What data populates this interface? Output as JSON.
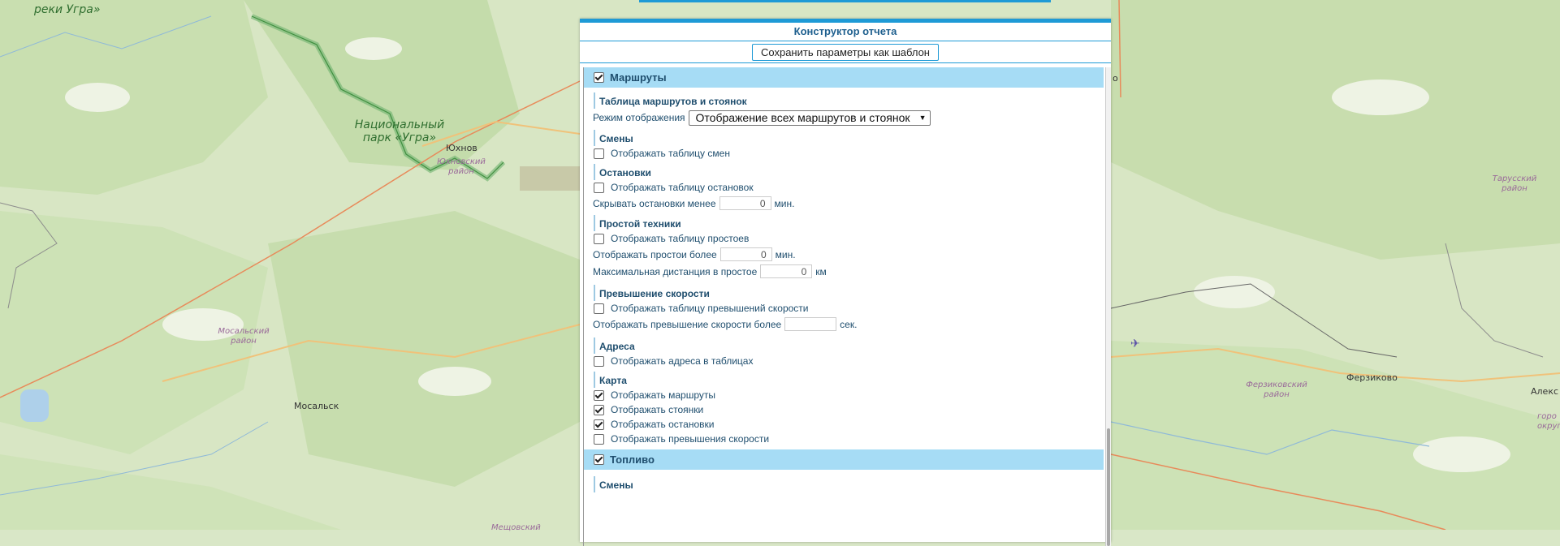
{
  "map": {
    "labels": {
      "river": "реки Угра»",
      "park_line1": "Национальный",
      "park_line2": "парк «Угра»",
      "yukhnov": "Юхнов",
      "yukhnov_rayon_1": "Юхновский",
      "yukhnov_rayon_2": "район",
      "mosalsk_rayon_1": "Мосальский",
      "mosalsk_rayon_2": "район",
      "mosalsk": "Мосальск",
      "meshchovsk_rayon": "Мещовский",
      "tarussky_rayon_1": "Тарусский",
      "tarussky_rayon_2": "район",
      "ferzikovo": "Ферзиково",
      "ferzikovo_rayon_1": "Ферзиковский",
      "ferzikovo_rayon_2": "район",
      "aleks": "Алекс",
      "goro_1": "горо",
      "goro_2": "округ",
      "o_fragment": "о"
    }
  },
  "panel": {
    "title": "Конструктор отчета",
    "save_button": "Сохранить параметры как шаблон",
    "groups": {
      "routes": {
        "label": "Маршруты",
        "checked": true,
        "table_title": "Таблица маршрутов и стоянок",
        "display_mode_label": "Режим отображения",
        "display_mode_value": "Отображение всех маршрутов и стоянок",
        "shifts_title": "Смены",
        "shifts_cb": "Отображать таблицу смен",
        "stops_title": "Остановки",
        "stops_cb": "Отображать таблицу остановок",
        "hide_stops_label": "Скрывать остановки менее",
        "hide_stops_value": "0",
        "hide_stops_unit": "мин.",
        "idle_title": "Простой техники",
        "idle_cb": "Отображать таблицу простоев",
        "idle_more_label": "Отображать простои более",
        "idle_more_value": "0",
        "idle_more_unit": "мин.",
        "idle_dist_label": "Максимальная дистанция в простое",
        "idle_dist_value": "0",
        "idle_dist_unit": "км",
        "speed_title": "Превышение скорости",
        "speed_cb": "Отображать таблицу превышений скорости",
        "speed_more_label": "Отображать превышение скорости более",
        "speed_more_value": "",
        "speed_more_unit": "сек.",
        "address_title": "Адреса",
        "address_cb": "Отображать адреса в таблицах",
        "map_title": "Карта",
        "map_cb_routes": "Отображать маршруты",
        "map_cb_parkings": "Отображать стоянки",
        "map_cb_stops": "Отображать остановки",
        "map_cb_speeding": "Отображать превышения скорости"
      },
      "fuel": {
        "label": "Топливо",
        "checked": true,
        "shifts_title": "Смены"
      }
    }
  }
}
